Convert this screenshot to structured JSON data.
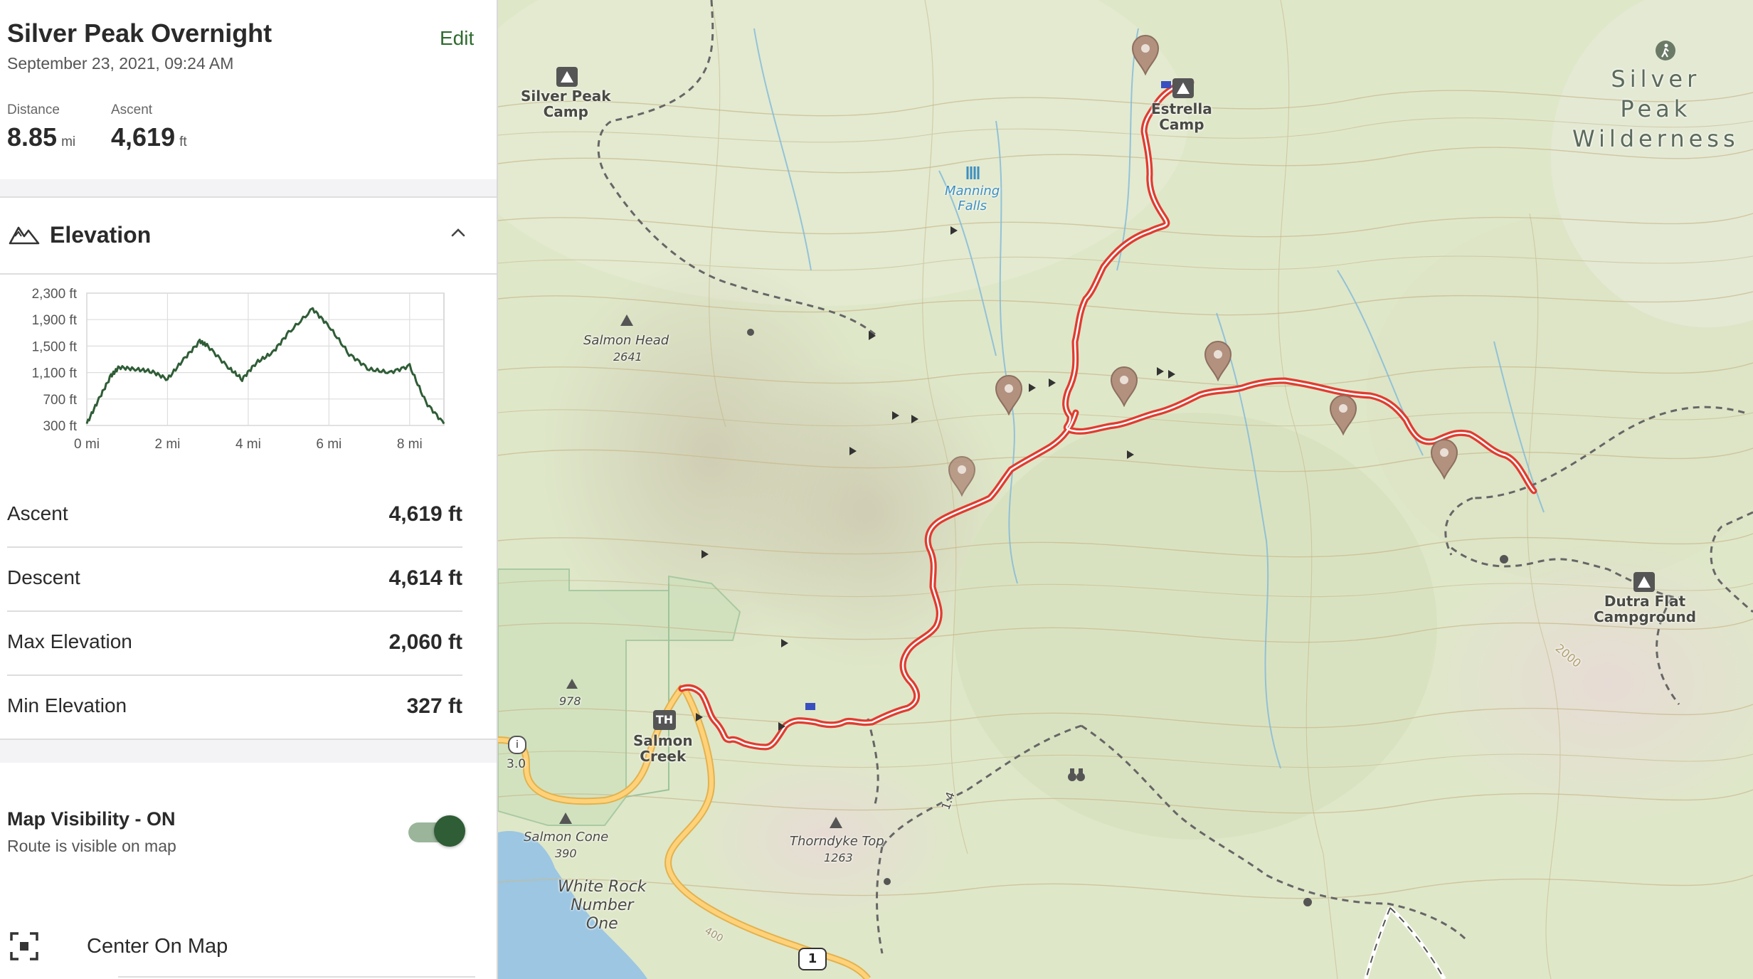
{
  "header": {
    "title": "Silver Peak Overnight",
    "date": "September 23, 2021, 09:24 AM",
    "edit_label": "Edit"
  },
  "summary": {
    "distance_label": "Distance",
    "distance_value": "8.85",
    "distance_unit": "mi",
    "ascent_label": "Ascent",
    "ascent_value": "4,619",
    "ascent_unit": "ft"
  },
  "elevation": {
    "section_title": "Elevation",
    "chart_data": {
      "type": "area",
      "title": "",
      "xlabel": "",
      "ylabel": "",
      "x_unit": "mi",
      "y_unit": "ft",
      "xlim": [
        0,
        8.85
      ],
      "ylim": [
        300,
        2300
      ],
      "y_ticks": [
        "2,300 ft",
        "1,900 ft",
        "1,500 ft",
        "1,100 ft",
        "700 ft",
        "300 ft"
      ],
      "x_ticks": [
        "0 mi",
        "2 mi",
        "4 mi",
        "6 mi",
        "8 mi"
      ],
      "grid": true,
      "x": [
        0,
        0.3,
        0.6,
        0.8,
        1.2,
        1.6,
        2.0,
        2.4,
        2.8,
        3.0,
        3.5,
        3.85,
        4.2,
        4.6,
        5.0,
        5.6,
        6.0,
        6.5,
        7.0,
        7.5,
        8.0,
        8.4,
        8.85
      ],
      "series": [
        {
          "values": [
            327,
            700,
            1050,
            1180,
            1150,
            1120,
            1000,
            1300,
            1570,
            1500,
            1180,
            1000,
            1250,
            1400,
            1700,
            2060,
            1800,
            1380,
            1150,
            1100,
            1200,
            650,
            327
          ]
        }
      ]
    }
  },
  "stats": [
    {
      "label": "Ascent",
      "value": "4,619 ft"
    },
    {
      "label": "Descent",
      "value": "4,614 ft"
    },
    {
      "label": "Max Elevation",
      "value": "2,060 ft"
    },
    {
      "label": "Min Elevation",
      "value": "327 ft"
    }
  ],
  "visibility": {
    "title": "Map Visibility - ON",
    "subtitle": "Route is visible on map",
    "enabled": true
  },
  "actions": {
    "center_on_map": "Center On Map"
  },
  "map": {
    "route_color": "#e03c31",
    "labels": {
      "silver_peak_camp": [
        "Silver Peak",
        "Camp"
      ],
      "estrella_camp": [
        "Estrella",
        "Camp"
      ],
      "manning_falls": [
        "Manning",
        "Falls"
      ],
      "salmon_head": "Salmon Head",
      "salmon_head_elev": "2641",
      "wilderness": [
        "Silver",
        "Peak",
        "Wilderness"
      ],
      "dutra_flat": [
        "Dutra Flat",
        "Campground"
      ],
      "salmon_creek": [
        "Salmon",
        "Creek"
      ],
      "salmon_cone": "Salmon Cone",
      "salmon_cone_elev": "390",
      "thorndyke_top": "Thorndyke Top",
      "thorndyke_elev": "1263",
      "white_rock": [
        "White Rock",
        "Number",
        "One"
      ],
      "peak_978": "978",
      "road_3": "3.0",
      "road_14": "1.4",
      "contour_2000": "2000",
      "road_400": "400",
      "highway_1": "1"
    }
  }
}
